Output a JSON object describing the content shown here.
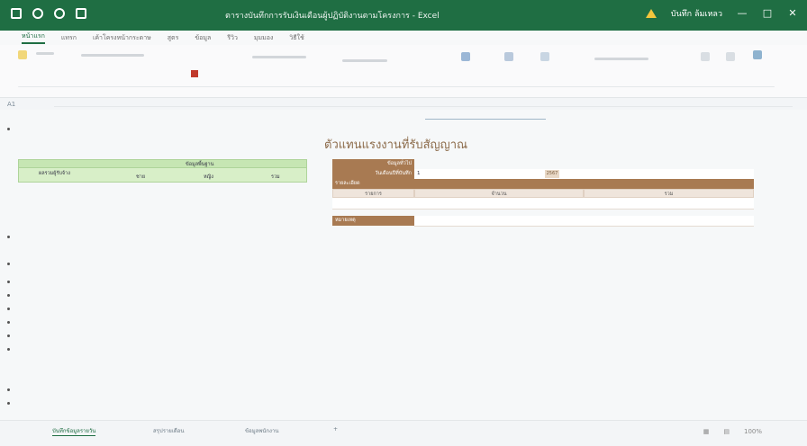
{
  "window": {
    "title": "ตารางบันทึกการรับเงินเดือนผู้ปฏิบัติงานตามโครงการ - Excel",
    "warning_label": "บันทึก ล้มเหลว",
    "controls": [
      "—",
      "□",
      "✕"
    ]
  },
  "ribbon": {
    "tabs": [
      {
        "label": "หน้าแรก",
        "active": true
      },
      {
        "label": "แทรก",
        "active": false
      },
      {
        "label": "เค้าโครงหน้ากระดาษ",
        "active": false
      },
      {
        "label": "สูตร",
        "active": false
      },
      {
        "label": "ข้อมูล",
        "active": false
      },
      {
        "label": "รีวิว",
        "active": false
      },
      {
        "label": "มุมมอง",
        "active": false
      },
      {
        "label": "วิธีใช้",
        "active": false
      }
    ]
  },
  "formula_bar": {
    "name_box": "A1"
  },
  "sheet": {
    "title": "ตัวแทนแรงงานที่รับสัญญาณ",
    "green_table": {
      "header": "ข้อมูลพื้นฐาน",
      "row_label": "ผลรวมผู้รับจ้าง",
      "col_a": "ชาย",
      "col_b": "หญิง",
      "col_c": "รวม"
    },
    "form": {
      "label_1": "ข้อมูลทั่วไป",
      "label_2": "วันเดือนปีที่บันทึก",
      "value_2": "1",
      "box_value": "2567",
      "label_3": "รายละเอียด",
      "col_label": "รายการ",
      "col_mid": "จำนวน",
      "col_right": "รวม",
      "label_4": "หมายเหตุ"
    }
  },
  "sheet_tabs": [
    {
      "label": "บันทึกข้อมูลรายวัน",
      "active": true
    },
    {
      "label": "สรุปรายเดือน",
      "active": false
    },
    {
      "label": "ข้อมูลพนักงาน",
      "active": false
    },
    {
      "label": "+",
      "active": false
    }
  ],
  "status_bar": {
    "zoom": "100%"
  }
}
